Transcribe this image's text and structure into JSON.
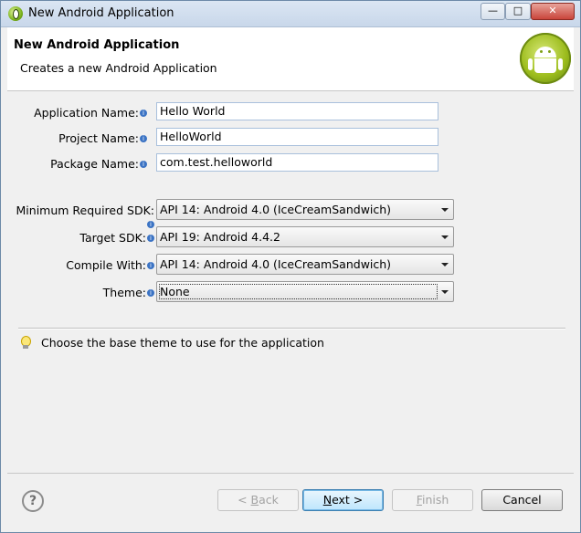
{
  "window": {
    "title": "New Android Application"
  },
  "header": {
    "title": "New Android Application",
    "subtitle": "Creates a new Android Application"
  },
  "form": {
    "app_name_label": "Application Name:",
    "app_name_value": "Hello World",
    "project_name_label": "Project Name:",
    "project_name_value": "HelloWorld",
    "package_name_label": "Package Name:",
    "package_name_value": "com.test.helloworld",
    "min_sdk_label": "Minimum Required SDK:",
    "min_sdk_value": "API 14: Android 4.0 (IceCreamSandwich)",
    "target_sdk_label": "Target SDK:",
    "target_sdk_value": "API 19: Android 4.4.2",
    "compile_with_label": "Compile With:",
    "compile_with_value": "API 14: Android 4.0 (IceCreamSandwich)",
    "theme_label": "Theme:",
    "theme_value": "None"
  },
  "hint": "Choose the base theme to use for the application",
  "buttons": {
    "back_prefix": "< ",
    "back_access": "B",
    "back_rest": "ack",
    "next_access": "N",
    "next_rest": "ext >",
    "finish_access": "F",
    "finish_rest": "inish",
    "cancel": "Cancel"
  },
  "icons": [
    "app-icon",
    "android-logo-icon",
    "info-icon",
    "dropdown-arrow-icon",
    "lightbulb-icon",
    "help-icon"
  ]
}
